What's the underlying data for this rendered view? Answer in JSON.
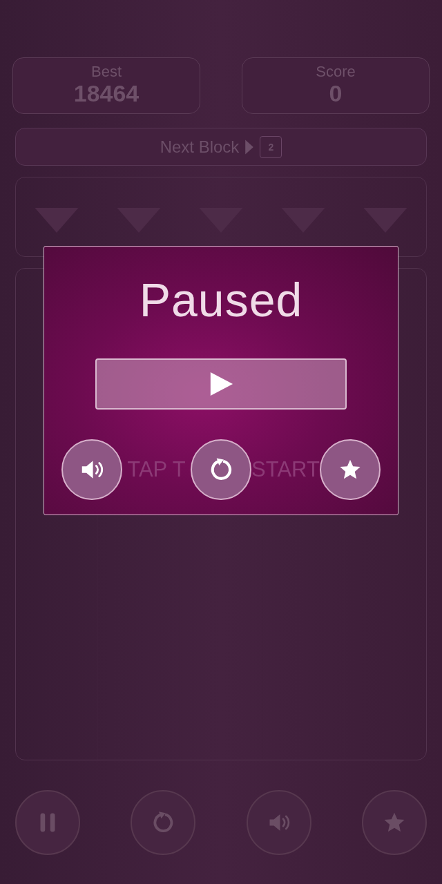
{
  "scores": [
    {
      "label": "Best",
      "value": "18464"
    },
    {
      "label": "Score",
      "value": "0"
    }
  ],
  "next_block": {
    "label": "Next Block",
    "value": "2"
  },
  "board": {
    "hint_parts": [
      "TAP T",
      "START"
    ]
  },
  "pause_dialog": {
    "title": "Paused",
    "actions": [
      {
        "kind": "sound"
      },
      {
        "kind": "restart"
      },
      {
        "kind": "star"
      }
    ]
  },
  "toolbar": [
    {
      "kind": "pause"
    },
    {
      "kind": "restart"
    },
    {
      "kind": "sound"
    },
    {
      "kind": "star"
    }
  ]
}
